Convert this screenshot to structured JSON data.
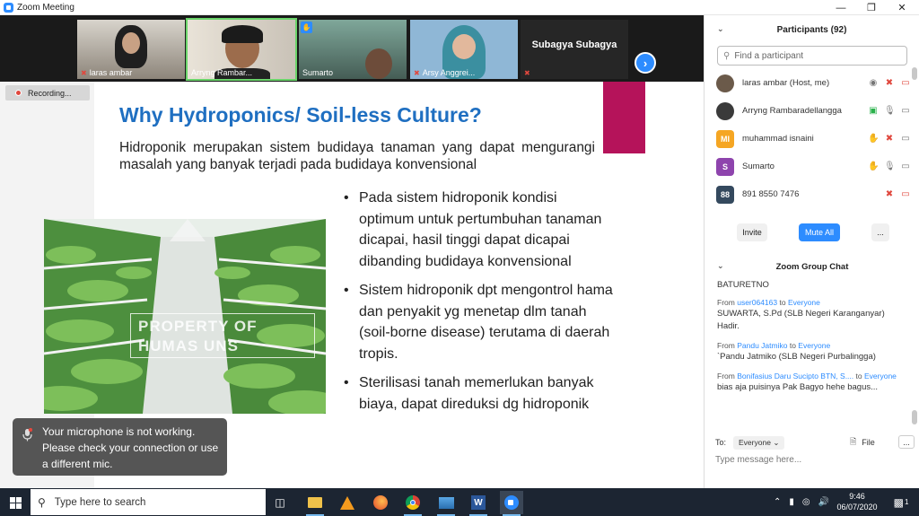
{
  "window": {
    "title": "Zoom Meeting"
  },
  "video_strip": {
    "tiles": [
      {
        "name": "laras ambar",
        "muted": true
      },
      {
        "name": "Arryng Rambar...",
        "muted": false
      },
      {
        "name": "Sumarto",
        "muted": false,
        "hand_raised": true
      },
      {
        "name": "Arsy Anggrei...",
        "muted": true
      },
      {
        "name": "Subagya Subagya",
        "muted": true
      }
    ]
  },
  "recording": {
    "label": "Recording..."
  },
  "slide": {
    "title": "Why Hydroponics/ Soil-less Culture?",
    "intro": "Hidroponik merupakan sistem budidaya tanaman yang dapat mengurangi masalah yang banyak terjadi pada budidaya konvensional",
    "bullets": [
      "Pada sistem hidroponik kondisi optimum untuk pertumbuhan tanaman dicapai, hasil tinggi dapat dicapai dibanding budidaya konvensional",
      "Sistem hidroponik dpt mengontrol hama dan penyakit yg menetap dlm tanah (soil-borne disease) terutama di daerah tropis.",
      "Sterilisasi tanah memerlukan banyak biaya, dapat direduksi dg hidroponik"
    ],
    "watermark_line1": "PROPERTY OF",
    "watermark_line2": "HUMAS UNS"
  },
  "toast": {
    "message": "Your microphone is not working. Please check your connection or use a different mic."
  },
  "participants": {
    "title": "Participants (92)",
    "search_placeholder": "Find a participant",
    "list": [
      {
        "name": "laras ambar (Host, me)",
        "avatar": "",
        "color": "#6b5a4a"
      },
      {
        "name": "Arryng Rambaradellangga",
        "avatar": "",
        "color": "#3a3a3a"
      },
      {
        "name": "muhammad isnaini",
        "avatar": "MI",
        "color": "#f5a623"
      },
      {
        "name": "Sumarto",
        "avatar": "S",
        "color": "#8e44ad"
      },
      {
        "name": "891 8550 7476",
        "avatar": "88",
        "color": "#34495e"
      }
    ],
    "buttons": {
      "invite": "Invite",
      "mute_all": "Mute All",
      "more": "..."
    }
  },
  "chat": {
    "title": "Zoom Group Chat",
    "partial_top": "BATURETNO",
    "messages": [
      {
        "from_label": "From",
        "sender": "user064163",
        "to_label": "to",
        "recipient": "Everyone",
        "text": "SUWARTA, S.Pd (SLB Negeri Karanganyar) Hadir."
      },
      {
        "from_label": "From",
        "sender": "Pandu Jatmiko",
        "to_label": "to",
        "recipient": "Everyone",
        "text": "`Pandu Jatmiko (SLB Negeri Purbalingga)"
      },
      {
        "from_label": "From",
        "sender": "Bonifasius Daru Sucipto BTN, S....",
        "to_label": "to",
        "recipient": "Everyone",
        "text": "bias aja puisinya Pak Bagyo hehe bagus..."
      }
    ],
    "to_label": "To:",
    "to_value": "Everyone",
    "file_label": "File",
    "more": "...",
    "input_placeholder": "Type message here..."
  },
  "taskbar": {
    "search_placeholder": "Type here to search",
    "time": "9:46",
    "date": "06/07/2020",
    "notification_count": "1"
  }
}
